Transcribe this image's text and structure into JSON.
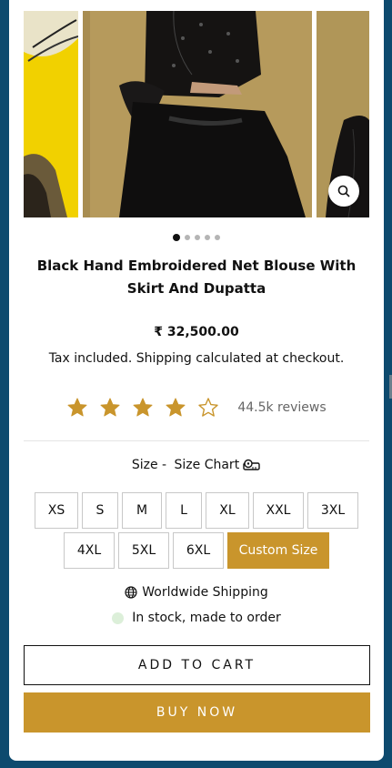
{
  "product": {
    "title": "Black Hand Embroidered Net Blouse With Skirt And Dupatta",
    "price": "₹ 32,500.00",
    "tax_note": "Tax included. Shipping calculated at checkout."
  },
  "gallery": {
    "image_count": 5,
    "active_index": 0,
    "zoom_icon": "search-icon"
  },
  "rating": {
    "stars": 4,
    "max_stars": 5,
    "reviews_label": "44.5k reviews",
    "star_color": "#c9952c"
  },
  "size": {
    "label": "Size - ",
    "chart_label": "Size Chart",
    "chart_icon": "measuring-tape-icon",
    "options_row1": [
      "XS",
      "S",
      "M",
      "L",
      "XL",
      "XXL",
      "3XL"
    ],
    "options_row2": [
      "4XL",
      "5XL",
      "6XL",
      "Custom Size"
    ],
    "selected": "Custom Size"
  },
  "shipping": {
    "label": "Worldwide Shipping",
    "icon": "globe-icon"
  },
  "stock": {
    "label": "In stock, made to order",
    "dot_color": "#dcefd9"
  },
  "actions": {
    "add_to_cart": "ADD TO CART",
    "buy_now": "BUY NOW"
  },
  "colors": {
    "accent": "#c9952c",
    "backdrop": "#0d4a6e"
  }
}
